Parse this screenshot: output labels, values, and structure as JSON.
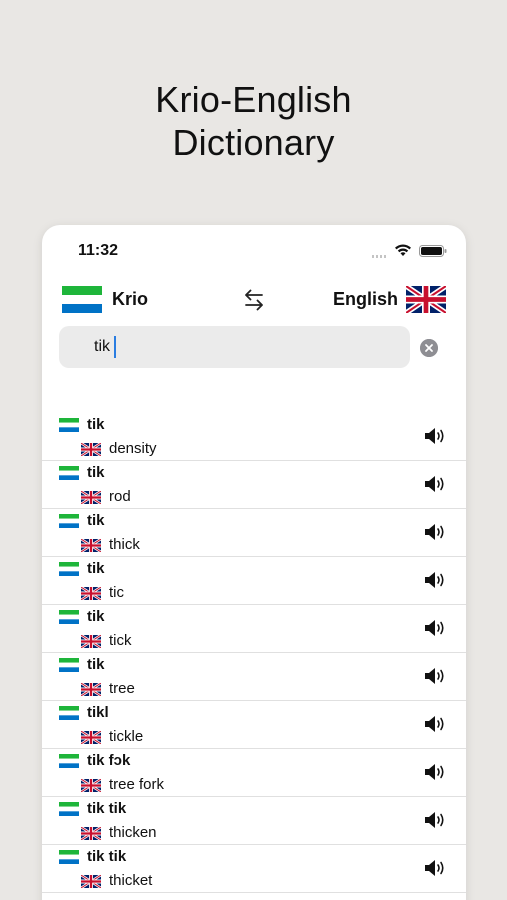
{
  "headline": {
    "line1": "Krio-English",
    "line2": "Dictionary"
  },
  "status_bar": {
    "time": "11:32"
  },
  "languages": {
    "source": "Krio",
    "target": "English",
    "source_flag_icon": "sierra-leone-flag-icon",
    "target_flag_icon": "uk-flag-icon",
    "swap_icon": "swap-arrows-icon"
  },
  "search": {
    "value": "tik",
    "clear_icon": "clear-circle-icon"
  },
  "results": [
    {
      "krio": "tik",
      "english": "density"
    },
    {
      "krio": "tik",
      "english": "rod"
    },
    {
      "krio": "tik",
      "english": "thick"
    },
    {
      "krio": "tik",
      "english": "tic"
    },
    {
      "krio": "tik",
      "english": "tick"
    },
    {
      "krio": "tik",
      "english": "tree"
    },
    {
      "krio": "tikl",
      "english": "tickle"
    },
    {
      "krio": "tik fɔk",
      "english": "tree fork"
    },
    {
      "krio": "tik tik",
      "english": "thicken"
    },
    {
      "krio": "tik tik",
      "english": "thicket"
    }
  ],
  "colors": {
    "background": "#e9e7e4",
    "sl_green": "#1eb53a",
    "sl_blue": "#0072c6",
    "uk_blue": "#012169",
    "uk_red": "#c8102e",
    "caret": "#2a7de1"
  }
}
